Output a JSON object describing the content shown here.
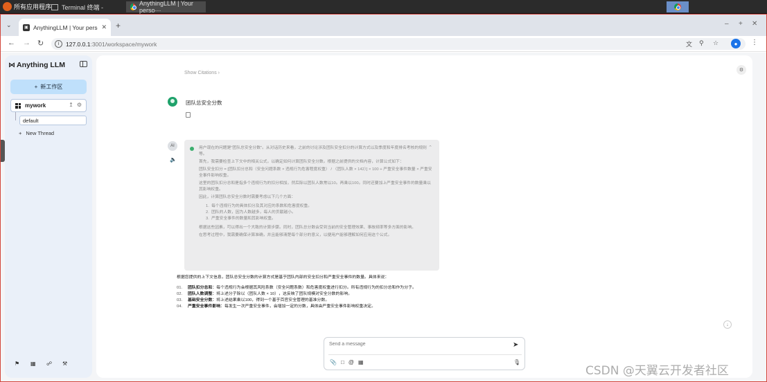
{
  "os": {
    "apps_label": "所有应用程序",
    "terminal_task": "Terminal 终端 -",
    "chrome_task": "AnythingLLM | Your perso···"
  },
  "browser": {
    "tab_title": "AnythingLLM | Your perso",
    "url_host": "127.0.0.1",
    "url_path": ":3001/workspace/mywork"
  },
  "sidebar": {
    "brand": "Anything LLM",
    "new_workspace_label": "新工作区",
    "workspace_name": "mywork",
    "thread_default": "default",
    "new_thread_label": "New Thread"
  },
  "chat": {
    "show_citations": "Show Citations",
    "user_message": "团队总安全分数",
    "bot_avatar_label": "AI",
    "thinking": {
      "p1": "用户现在的问题是\"团队总安全分数\"。从对话历史来看，之前的讨论涉及团队安全扣分的计算方式以及季度和年度排名考核的规则等。",
      "p2": "首先，我需要检查上下文中的相关公式，以确定如何计算团队安全分数。根据之前提供的文档内容，计算公式如下：",
      "p3": "团队安全扣分 = [团队扣分总和（安全问题系数 × 违规行为危害程度权重） / （团队人数 × 142）] × 100 + 严重安全事件数量 × 严重安全事件影响权重。",
      "p4": "这里的团队扣分总和是指多个违规行为的扣分相加，然后除以团队人数常以10。再乘以100。同时还要加上严重安全事件的数量乘以其影响权重。",
      "p5": "因此，计算团队总安全分数时需要考虑以下几个方面：",
      "items": [
        {
          "num": "1.",
          "text": "每个违规行为的具体扣分及其对应的系数和危害度权重。"
        },
        {
          "num": "2.",
          "text": "团队的人数，因为人数越多，每人的贡献越小。"
        },
        {
          "num": "3.",
          "text": "严重安全事件的数量和其影响权重。"
        }
      ],
      "p6": "根据这些因素，可以得出一个大致的计算步骤。同时，团队总分数会受到当前的安全管理效果、事故频率等多方面的影响。",
      "p7": "在思考过程中，我需要确保计算准确，并且能够清楚每个部分的意义，以便用户能够理解如何应用这个公式。"
    },
    "answer": {
      "intro": "根据您提供的上下文信息，团队总安全分数的计算方式是基于团队内部的安全扣分和严重安全事件的数量。具体来说：",
      "items": [
        {
          "num": "01.",
          "term": "团队扣分总和",
          "text": "：每个违规行为会根据其风险系数（安全问题系数）和危害度权重进行扣分。所有违规行为的扣分总和作为分子。"
        },
        {
          "num": "02.",
          "term": "团队人数调整",
          "text": "：将上述分子除以（团队人数 × 10），这反映了团队规模对安全分数的影响。"
        },
        {
          "num": "03.",
          "term": "基础安全分数",
          "text": "：将上述结果乘以100，得到一个基于百官安全管理的基准分数。"
        },
        {
          "num": "04.",
          "term": "严重安全事件影响",
          "text": "：每发生一次严重安全事件，会增加一定的分数，具体由严重安全事件影响权重决定。"
        }
      ]
    },
    "composer_placeholder": "Send a message"
  },
  "watermark": "CSDN @天翼云开发者社区",
  "colors": {
    "accent_button": "#bfe0fb",
    "sidebar_bg": "#eaf0f9",
    "user_avatar": "#1fa26b",
    "window_border": "#d2453b"
  }
}
